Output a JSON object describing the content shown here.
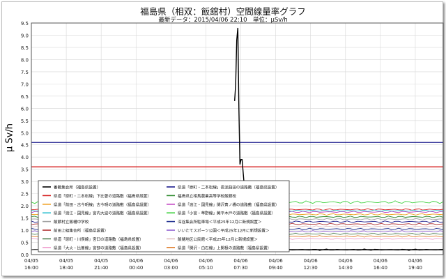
{
  "chart_data": {
    "type": "line",
    "title": "福島県（相双：飯舘村）空間線量率グラフ",
    "subtitle": "最新データ：2015/04/06 22:10　単位：μSv/h",
    "ylabel": "μ Sv/h",
    "ylim": [
      0,
      9.5
    ],
    "yticks": [
      "0.0",
      "0.5",
      "1.0",
      "1.5",
      "2.0",
      "2.5",
      "3.0",
      "3.5",
      "4.0",
      "4.5",
      "5.0",
      "5.5",
      "6.0",
      "6.5",
      "7.0",
      "7.5",
      "8.0",
      "8.5",
      "9.0",
      "9.5"
    ],
    "xticks": [
      [
        "04/05",
        "16:00"
      ],
      [
        "04/05",
        "18:40"
      ],
      [
        "04/05",
        "21:40"
      ],
      [
        "04/06",
        "00:40"
      ],
      [
        "04/06",
        "03:00"
      ],
      [
        "04/06",
        "05:10"
      ],
      [
        "04/06",
        "07:30"
      ],
      [
        "04/06",
        "09:40"
      ],
      [
        "04/06",
        "12:30"
      ],
      [
        "04/06",
        "14:30"
      ],
      [
        "04/06",
        "16:40"
      ],
      [
        "04/06",
        "19:40"
      ]
    ],
    "reference_lines": [
      {
        "value": 4.6,
        "color": "#1a1a8c"
      },
      {
        "value": 3.6,
        "color": "#d62020"
      }
    ],
    "spike_series": {
      "color": "#000000",
      "x_hours": [
        15.3,
        15.38,
        15.46,
        15.54,
        15.62,
        15.7,
        15.78,
        15.86,
        16.0,
        16.15,
        16.3
      ],
      "values": [
        6.3,
        7.0,
        8.8,
        9.3,
        6.0,
        3.7,
        3.9,
        3.9,
        3.0,
        1.2,
        0.4
      ]
    },
    "series": [
      {
        "name": "番敷集会所（福島県設置）",
        "color": "#000000",
        "value": 0.2
      },
      {
        "name": "県道「原町・二本松線」長泥曲田の道路敷（福島県設置）",
        "color": "#1a1a8c",
        "value": 1.35
      },
      {
        "name": "県道「原町・二本松線」下比曽の道路敷（福島県設置）",
        "color": "#d62020",
        "value": 1.85
      },
      {
        "name": "福島県立相馬農業高等学校飯舘校",
        "color": "#2e8b2e",
        "value": 1.55
      },
      {
        "name": "県道「前田・古今明線」古今明の道路敷（福島県設置）",
        "color": "#f0a020",
        "value": 1.65
      },
      {
        "name": "県道「浪江・国見線」関沢青ノ橋の道路敷（福島県設置）",
        "color": "#c040c0",
        "value": 1.75
      },
      {
        "name": "県道「浪江・国見線」宮内大波の道路敷（福島県設置）",
        "color": "#30c0d0",
        "value": 1.8
      },
      {
        "name": "県道「小宮・草野線」蕨平木戸の道路敷（福島県設置）",
        "color": "#40d040",
        "value": 2.15
      },
      {
        "name": "飯舘村立飯樋中学校",
        "color": "#a0a0a0",
        "value": 1.45
      },
      {
        "name": "深谷集会所駐車場＜平成25年12月に新規設置＞",
        "color": "#203090",
        "value": 1.05
      },
      {
        "name": "前田上組集会所（福島県設置）",
        "color": "#b03030",
        "value": 1.25
      },
      {
        "name": "いいたてスポーツ公園＜平成25年12月に新規設置＞",
        "color": "#9060d0",
        "value": 0.95
      },
      {
        "name": "県道「原町・川俣線」宮臼の道路敷（福島県設置）",
        "color": "#508050",
        "value": 0.85
      },
      {
        "name": "飯樋地区公民館＜平成25年12月に新規設置＞",
        "color": "#e0c0c0",
        "value": 1.15
      },
      {
        "name": "県道「大火・比曽線」宮部の道路敷（福島県設置）",
        "color": "#f0a0d0",
        "value": 0.65
      },
      {
        "name": "県道「関沢・白石線」上関根の道路敷（福島県設置）",
        "color": "#e08030",
        "value": 0.75
      }
    ]
  }
}
